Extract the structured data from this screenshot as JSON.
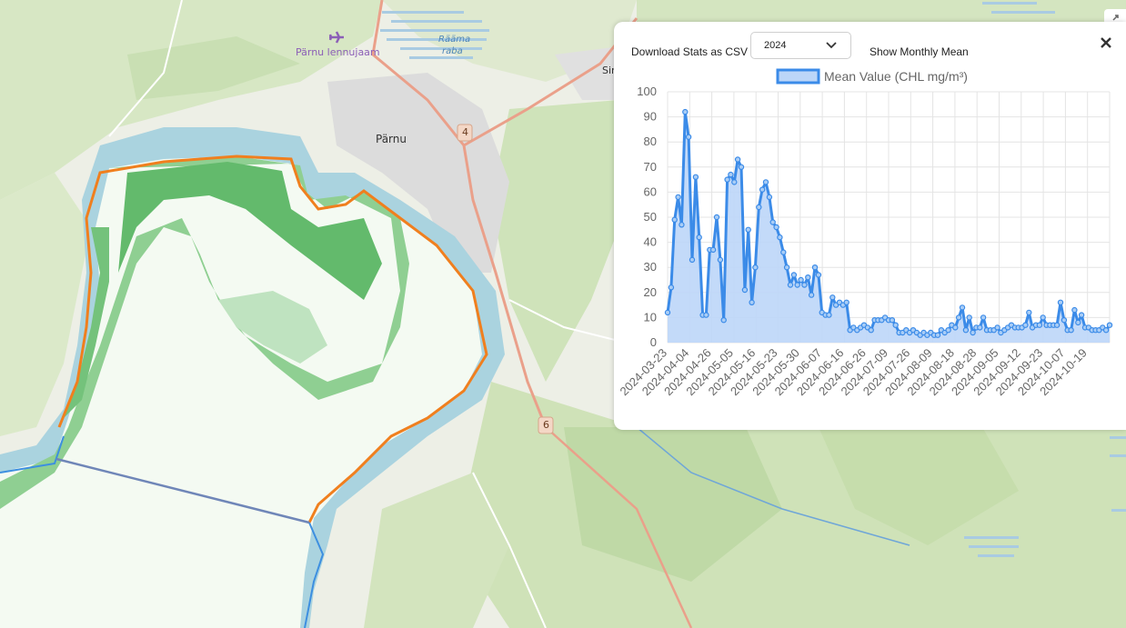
{
  "map": {
    "labels": {
      "airport": "Pärnu lennujaam",
      "bog_line1": "Rääma",
      "bog_line2": "raba",
      "city": "Pärnu",
      "sindi_partial": "Sind",
      "road_4": "4",
      "road_6": "6"
    },
    "icons": {
      "airport": "airplane-icon"
    }
  },
  "panel": {
    "download_label": "Download Stats as CSV",
    "year_select": {
      "value": "2024"
    },
    "show_monthly_label": "Show Monthly Mean",
    "close_icon": "close-icon"
  },
  "chart_data": {
    "type": "area",
    "legend": "Mean Value (CHL mg/m³)",
    "legend_placement": "top",
    "ylim": [
      0,
      100
    ],
    "yticks": [
      0,
      10,
      20,
      30,
      40,
      50,
      60,
      70,
      80,
      90,
      100
    ],
    "xticks": [
      "2024-03-23",
      "2024-04-04",
      "2024-04-26",
      "2024-05-05",
      "2024-05-16",
      "2024-05-23",
      "2024-05-30",
      "2024-06-07",
      "2024-06-16",
      "2024-06-26",
      "2024-07-09",
      "2024-07-26",
      "2024-08-09",
      "2024-08-18",
      "2024-08-28",
      "2024-09-05",
      "2024-09-12",
      "2024-09-23",
      "2024-10-07",
      "2024-10-19"
    ],
    "grid": true,
    "colors": {
      "line": "#3b8be8",
      "fill": "#bcd6f8",
      "grid": "#e4e4e4"
    },
    "series": [
      {
        "name": "Mean Value (CHL mg/m³)",
        "values": [
          12,
          22,
          49,
          58,
          47,
          92,
          82,
          33,
          66,
          42,
          11,
          11,
          37,
          37,
          50,
          33,
          9,
          65,
          67,
          64,
          73,
          70,
          21,
          45,
          16,
          30,
          54,
          61,
          64,
          58,
          48,
          46,
          42,
          36,
          30,
          23,
          27,
          23,
          25,
          23,
          26,
          19,
          30,
          27,
          12,
          11,
          11,
          18,
          15,
          16,
          15,
          16,
          5,
          6,
          5,
          6,
          7,
          6,
          5,
          9,
          9,
          9,
          10,
          9,
          9,
          7,
          4,
          4,
          5,
          4,
          5,
          4,
          3,
          4,
          3,
          4,
          3,
          3,
          5,
          4,
          5,
          7,
          6,
          10,
          14,
          5,
          10,
          4,
          6,
          6,
          10,
          5,
          5,
          5,
          6,
          4,
          5,
          6,
          7,
          6,
          6,
          6,
          7,
          12,
          6,
          7,
          7,
          10,
          7,
          7,
          7,
          7,
          16,
          9,
          5,
          5,
          13,
          8,
          11,
          6,
          6,
          5,
          5,
          5,
          6,
          5,
          7
        ]
      }
    ]
  }
}
